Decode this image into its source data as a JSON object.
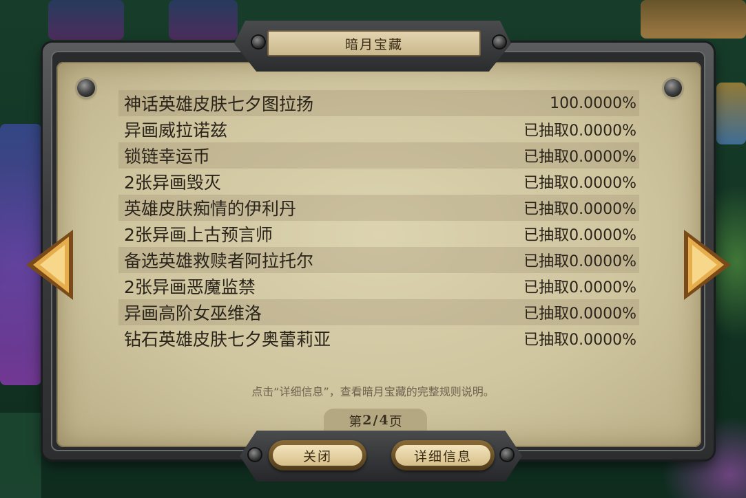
{
  "dialog": {
    "title": "暗月宝藏",
    "items": [
      {
        "name": "神话英雄皮肤七夕图拉扬",
        "value": "100.0000%"
      },
      {
        "name": "异画威拉诺兹",
        "value": "已抽取0.0000%"
      },
      {
        "name": "锁链幸运币",
        "value": "已抽取0.0000%"
      },
      {
        "name": "2张异画毁灭",
        "value": "已抽取0.0000%"
      },
      {
        "name": "英雄皮肤痴情的伊利丹",
        "value": "已抽取0.0000%"
      },
      {
        "name": "2张异画上古预言师",
        "value": "已抽取0.0000%"
      },
      {
        "name": "备选英雄救赎者阿拉托尔",
        "value": "已抽取0.0000%"
      },
      {
        "name": "2张异画恶魔监禁",
        "value": "已抽取0.0000%"
      },
      {
        "name": "异画高阶女巫维洛",
        "value": "已抽取0.0000%"
      },
      {
        "name": "钻石英雄皮肤七夕奥蕾莉亚",
        "value": "已抽取0.0000%"
      }
    ],
    "note": "点击“详细信息”，查看暗月宝藏的完整规则说明。",
    "page": {
      "prefix": "第",
      "current": "2",
      "sep": "/",
      "total": "4",
      "suffix": "页"
    },
    "buttons": {
      "close": "关闭",
      "details": "详细信息"
    }
  },
  "icons": {
    "prev": "left-arrow-icon",
    "next": "right-arrow-icon"
  },
  "colors": {
    "parchment": "#d6cca7",
    "frame": "#3b3c3e",
    "gold": "#e0a94a"
  }
}
